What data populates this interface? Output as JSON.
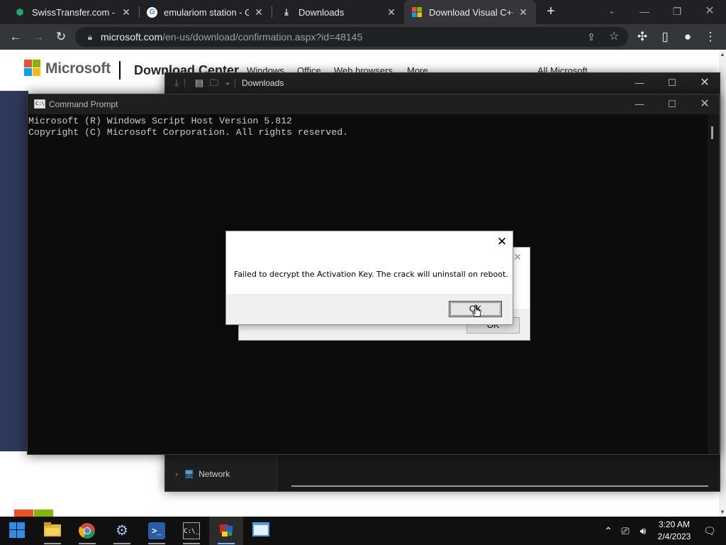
{
  "browser": {
    "tabs": [
      {
        "title": "SwissTransfer.com - Se",
        "favicon": "swisstransfer-icon"
      },
      {
        "title": "emulariom station - Go",
        "favicon": "google-icon"
      },
      {
        "title": "Downloads",
        "favicon": "download-icon"
      },
      {
        "title": "Download Visual C++ l",
        "favicon": "microsoft-icon",
        "active": true
      }
    ],
    "url_domain": "microsoft.com",
    "url_path": "/en-us/download/confirmation.aspx?id=48145"
  },
  "webpage": {
    "logo_text": "Microsoft",
    "section_title": "Download Center",
    "nav": [
      "Windows",
      "Office",
      "Web browsers",
      "More"
    ],
    "all_microsoft": "All Microsoft"
  },
  "explorer": {
    "title": "Downloads",
    "nav_network": "Network"
  },
  "cmd": {
    "title": "Command Prompt",
    "lines": [
      "Microsoft (R) Windows Script Host Version 5.812",
      "Copyright (C) Microsoft Corporation. All rights reserved."
    ]
  },
  "dialog": {
    "message": "Failed to decrypt the Activation Key. The crack will uninstall on reboot.",
    "ok_label": "OK"
  },
  "dialog_back": {
    "ok_label": "OK"
  },
  "taskbar": {
    "time": "3:20 AM",
    "date": "2/4/2023",
    "apps": [
      "start-icon",
      "file-explorer-icon",
      "chrome-icon",
      "settings-icon",
      "powershell-icon",
      "terminal-icon",
      "script-app-icon",
      "window-app-icon"
    ]
  },
  "colors": {
    "chrome_dark": "#202124",
    "chrome_toolbar": "#35363a",
    "cmd_bg": "#0c0c0c",
    "cmd_text": "#cccccc",
    "taskbar": "#101010"
  }
}
